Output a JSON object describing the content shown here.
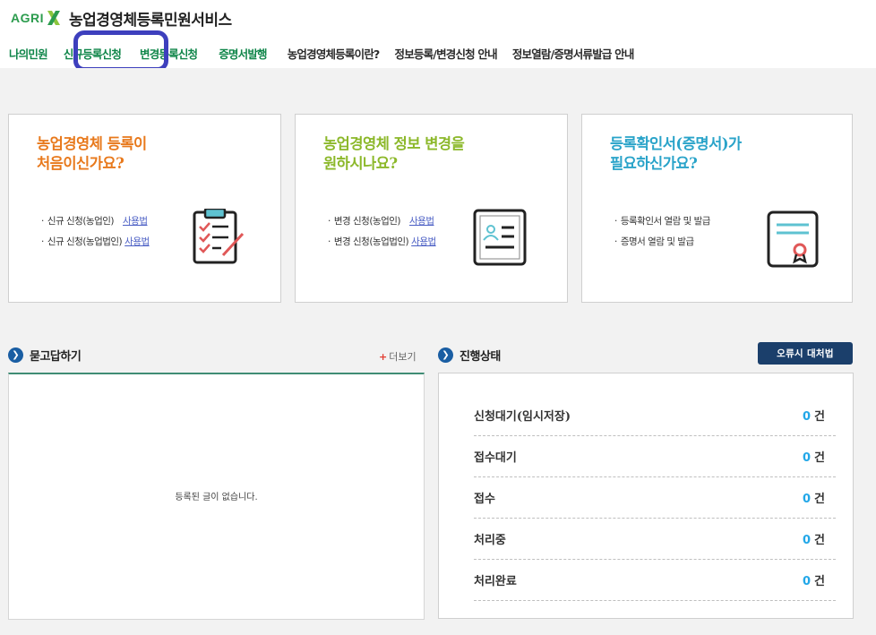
{
  "header": {
    "logo_text": "AGRI",
    "site_title": "농업경영체등록민원서비스"
  },
  "nav": {
    "items": [
      {
        "label": "나의민원",
        "color": "#10864a"
      },
      {
        "label": "신규등록신청",
        "color": "#10864a"
      },
      {
        "label": "변경등록신청",
        "color": "#10864a"
      },
      {
        "label": "증명서발행",
        "color": "#10864a"
      },
      {
        "label": "농업경영체등록이란?",
        "color": "#2a2a2a"
      },
      {
        "label": "정보등록/변경신청 안내",
        "color": "#2a2a2a"
      },
      {
        "label": "정보열람/증명서류발급 안내",
        "color": "#2a2a2a"
      }
    ],
    "highlighted": "신규등록신청",
    "highlight_color": "#3d3fbd"
  },
  "cards": [
    {
      "title_line1": "농업경영체 등록이",
      "title_line2": "처음이신가요?",
      "title_color": "#e8791c",
      "items": [
        {
          "text": "신규 신청(농업인)",
          "link": "사용법"
        },
        {
          "text": "신규 신청(농업법인)",
          "link": "사용법"
        }
      ],
      "icon": "checklist-icon"
    },
    {
      "title_line1": "농업경영체 정보 변경을",
      "title_line2": "원하시나요?",
      "title_color": "#8cb82a",
      "items": [
        {
          "text": "변경 신청(농업인)",
          "link": "사용법"
        },
        {
          "text": "변경 신청(농업법인)",
          "link": "사용법"
        }
      ],
      "icon": "profile-card-icon"
    },
    {
      "title_line1": "등록확인서(증명서)가",
      "title_line2": "필요하신가요?",
      "title_color": "#29a3c9",
      "items": [
        {
          "text": "등록확인서 열람 및 발급"
        },
        {
          "text": "증명서 열람 및 발급"
        }
      ],
      "icon": "certificate-icon"
    }
  ],
  "qa": {
    "title": "묻고답하기",
    "more_label": "더보기",
    "empty_text": "등록된 글이 없습니다."
  },
  "status": {
    "title": "진행상태",
    "fix_button": "오류시 대처법",
    "unit": "건",
    "rows": [
      {
        "label": "신청대기(임시저장)",
        "count": "0"
      },
      {
        "label": "접수대기",
        "count": "0"
      },
      {
        "label": "접수",
        "count": "0"
      },
      {
        "label": "처리중",
        "count": "0"
      },
      {
        "label": "처리완료",
        "count": "0"
      }
    ],
    "count_color": "#22a7e8"
  }
}
